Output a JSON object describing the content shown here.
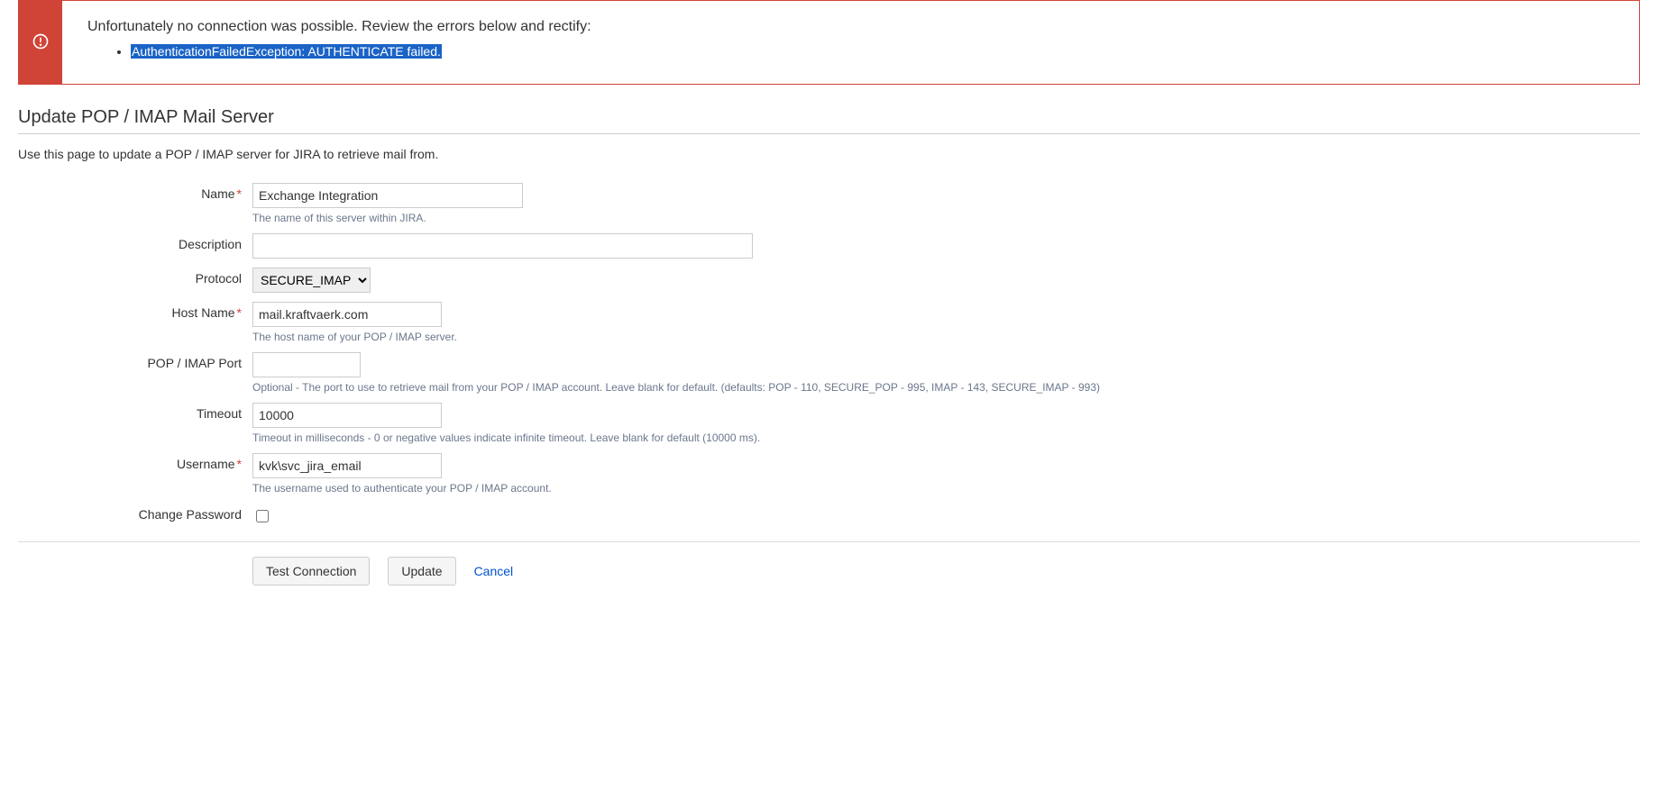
{
  "error": {
    "heading": "Unfortunately no connection was possible. Review the errors below and rectify:",
    "items": [
      "AuthenticationFailedException: AUTHENTICATE failed."
    ]
  },
  "page": {
    "title": "Update POP / IMAP Mail Server",
    "description": "Use this page to update a POP / IMAP server for JIRA to retrieve mail from."
  },
  "form": {
    "name": {
      "label": "Name",
      "value": "Exchange Integration",
      "hint": "The name of this server within JIRA."
    },
    "description": {
      "label": "Description",
      "value": ""
    },
    "protocol": {
      "label": "Protocol",
      "value": "SECURE_IMAP"
    },
    "host": {
      "label": "Host Name",
      "value": "mail.kraftvaerk.com",
      "hint": "The host name of your POP / IMAP server."
    },
    "port": {
      "label": "POP / IMAP Port",
      "value": "",
      "hint": "Optional - The port to use to retrieve mail from your POP / IMAP account. Leave blank for default. (defaults: POP - 110, SECURE_POP - 995, IMAP - 143, SECURE_IMAP - 993)"
    },
    "timeout": {
      "label": "Timeout",
      "value": "10000",
      "hint": "Timeout in milliseconds - 0 or negative values indicate infinite timeout. Leave blank for default (10000 ms)."
    },
    "username": {
      "label": "Username",
      "value": "kvk\\svc_jira_email",
      "hint": "The username used to authenticate your POP / IMAP account."
    },
    "changePassword": {
      "label": "Change Password"
    }
  },
  "actions": {
    "test": "Test Connection",
    "update": "Update",
    "cancel": "Cancel"
  }
}
